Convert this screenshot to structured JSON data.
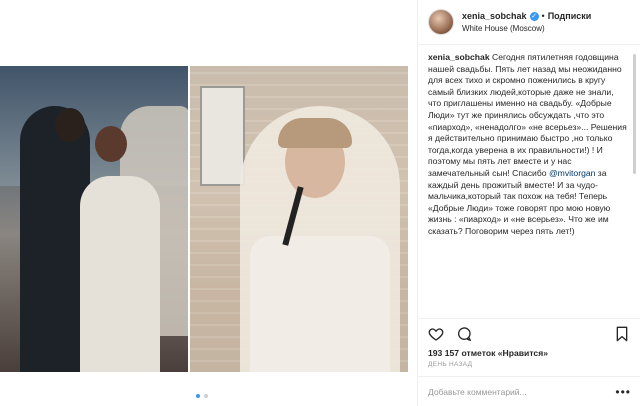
{
  "post": {
    "username": "xenia_sobchak",
    "dot": "•",
    "follow_label": "Подписки",
    "location": "White House (Moscow)"
  },
  "caption": {
    "author": "xenia_sobchak",
    "part1": " Сегодня пятилетняя годовщина нашей свадьбы. Пять лет назад мы неожиданно для всех тихо и скромно поженились в кругу самый близких людей,которые даже не знали, что приглашены именно на свадьбу. «Добрые Люди» тут же принялись обсуждать ,что это «пиарход», «ненадолго» «не всерьез»... Решения я действительно принимаю быстро ,но только тогда,когда уверена в их правильности!) ! И поэтому мы пять лет вместе и у нас замечательный сын! Спасибо ",
    "mention": "@mvitorgan",
    "part2": " за каждый день прожитый вместе! И за чудо-мальчика,который так похож на тебя! Теперь «Добрые Люди» тоже говорят про мою новую жизнь : «пиарход» и «не всерьез». Что же им сказать? Поговорим через пять лет!)"
  },
  "stats": {
    "likes": "193 157 отметок «Нравится»",
    "time": "ДЕНЬ НАЗАД"
  },
  "comment": {
    "placeholder": "Добавьте комментарий...",
    "more": "•••"
  },
  "carousel": {
    "count": 2,
    "active": 1
  }
}
